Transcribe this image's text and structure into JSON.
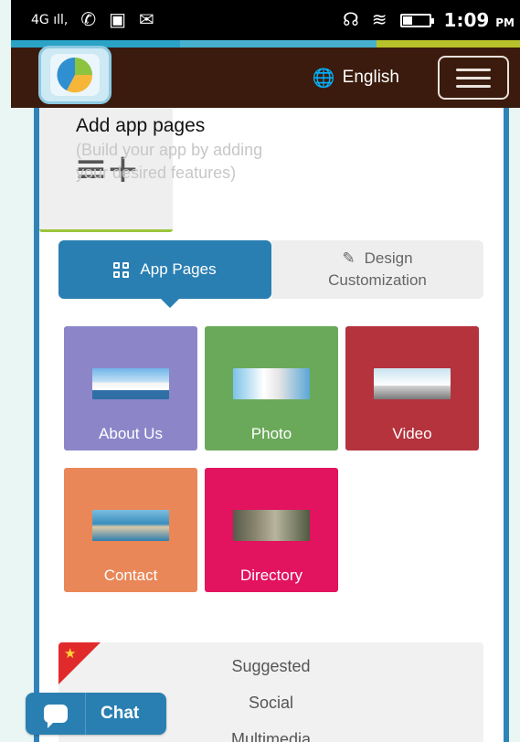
{
  "statusbar": {
    "network": "4G",
    "time": "1:09",
    "ampm": "PM",
    "icons": [
      "signal-icon",
      "whatsapp-icon",
      "gallery-icon",
      "messenger-icon",
      "headset-icon",
      "wifi-icon",
      "battery-icon"
    ]
  },
  "header": {
    "language_label": "English",
    "icons": [
      "app-logo-icon",
      "globe-icon",
      "hamburger-menu-icon"
    ]
  },
  "content": {
    "title": "Add app pages",
    "subtitle": "(Build your app by adding your desired features)"
  },
  "tabs": [
    {
      "label": "App Pages",
      "icon": "grid-icon",
      "active": true
    },
    {
      "label_line1": "Design",
      "label_line2": "Customization",
      "icon": "edit-icon",
      "active": false
    }
  ],
  "pages": [
    {
      "label": "About Us",
      "color": "#8c86c9"
    },
    {
      "label": "Photo",
      "color": "#6aa95a"
    },
    {
      "label": "Video",
      "color": "#b4333d"
    },
    {
      "label": "Contact",
      "color": "#e98758"
    },
    {
      "label": "Directory",
      "color": "#e2135f"
    },
    {
      "icon": "add-page-icon",
      "icon_glyph": "≡+"
    }
  ],
  "features": {
    "items": [
      "Suggested",
      "Social",
      "Multimedia"
    ],
    "ribbon_icon": "star-icon"
  },
  "chat": {
    "label": "Chat",
    "icon": "chat-bubble-icon"
  },
  "colors": {
    "appbar": "#3b1b0d",
    "accent": "#2a7fb2",
    "border": "#2f83b8"
  }
}
